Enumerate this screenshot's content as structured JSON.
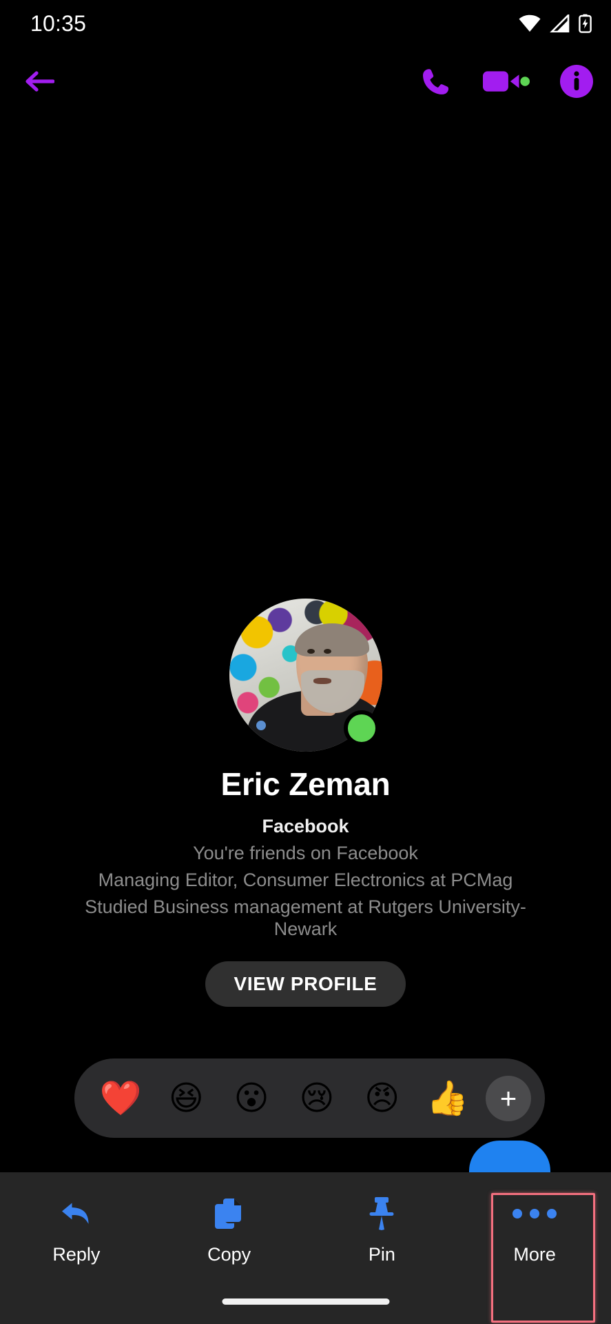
{
  "status_bar": {
    "time": "10:35",
    "icons": [
      "wifi-icon",
      "cellular-signal-icon",
      "battery-charging-icon"
    ]
  },
  "header": {
    "back_icon": "arrow-left-icon",
    "accent_color": "#a21df0",
    "actions": [
      {
        "name": "audio-call",
        "icon": "phone-icon"
      },
      {
        "name": "video-call",
        "icon": "video-camera-icon",
        "status_dot_color": "#5ed554"
      },
      {
        "name": "conversation-info",
        "icon": "info-circle-icon"
      }
    ]
  },
  "profile": {
    "avatar_alt": "profile-photo",
    "online": true,
    "online_color": "#5ed554",
    "name": "Eric Zeman",
    "source": "Facebook",
    "meta_1": "You're friends on Facebook",
    "meta_2": "Managing Editor, Consumer Electronics at PCMag",
    "meta_3": "Studied Business management at Rutgers University-Newark",
    "view_profile_label": "VIEW PROFILE"
  },
  "reaction_bar": {
    "reactions": [
      {
        "name": "heart-reaction",
        "glyph": "❤️"
      },
      {
        "name": "laughing-reaction",
        "glyph": "😆"
      },
      {
        "name": "wow-reaction",
        "glyph": "😮"
      },
      {
        "name": "sad-reaction",
        "glyph": "😢"
      },
      {
        "name": "angry-reaction",
        "glyph": "😠"
      },
      {
        "name": "thumbs-up-reaction",
        "glyph": "👍"
      }
    ],
    "add_label": "+",
    "background": "#2c2c2e"
  },
  "message_bubble": {
    "color": "#1f82f0"
  },
  "action_sheet": {
    "background": "#262626",
    "icon_color": "#3b83f0",
    "highlight_color": "#f4707f",
    "items": [
      {
        "name": "reply",
        "icon": "reply-arrow-icon",
        "label": "Reply",
        "highlighted": false
      },
      {
        "name": "copy",
        "icon": "copy-documents-icon",
        "label": "Copy",
        "highlighted": false
      },
      {
        "name": "pin",
        "icon": "pushpin-icon",
        "label": "Pin",
        "highlighted": false
      },
      {
        "name": "more",
        "icon": "ellipsis-icon",
        "label": "More",
        "highlighted": true
      }
    ]
  }
}
